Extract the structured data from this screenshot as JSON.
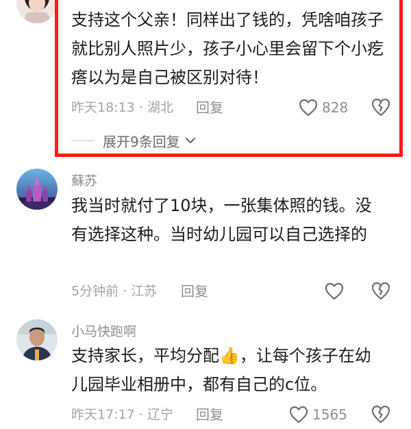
{
  "comments": [
    {
      "user": "",
      "text": "支持这个父亲！同样出了钱的，凭啥咱孩子就比别人照片少，孩子小心里会留下个小疙瘩以为是自己被区别对待！",
      "time": "昨天18:13",
      "location": "湖北",
      "reply_label": "回复",
      "likes": "828",
      "expand_label": "展开9条回复"
    },
    {
      "user": "蘇苏",
      "text": "我当时就付了10块，一张集体照的钱。没有选择这种。当时幼儿园可以自己选择的",
      "time": "5分钟前",
      "location": "江苏",
      "reply_label": "回复",
      "likes": ""
    },
    {
      "user": "小马快跑啊",
      "text_before": "支持家长，平均分配",
      "emoji": "👍",
      "text_after": "，让每个孩子在幼儿园毕业相册中，都有自己的c位。",
      "time": "昨天17:17",
      "location": "辽宁",
      "reply_label": "回复",
      "likes": "1565"
    }
  ],
  "separator": " · ",
  "colors": {
    "highlight_border": "#ff1a1a",
    "meta_text": "#a0a4ab",
    "body_text": "#1c1c1c"
  }
}
